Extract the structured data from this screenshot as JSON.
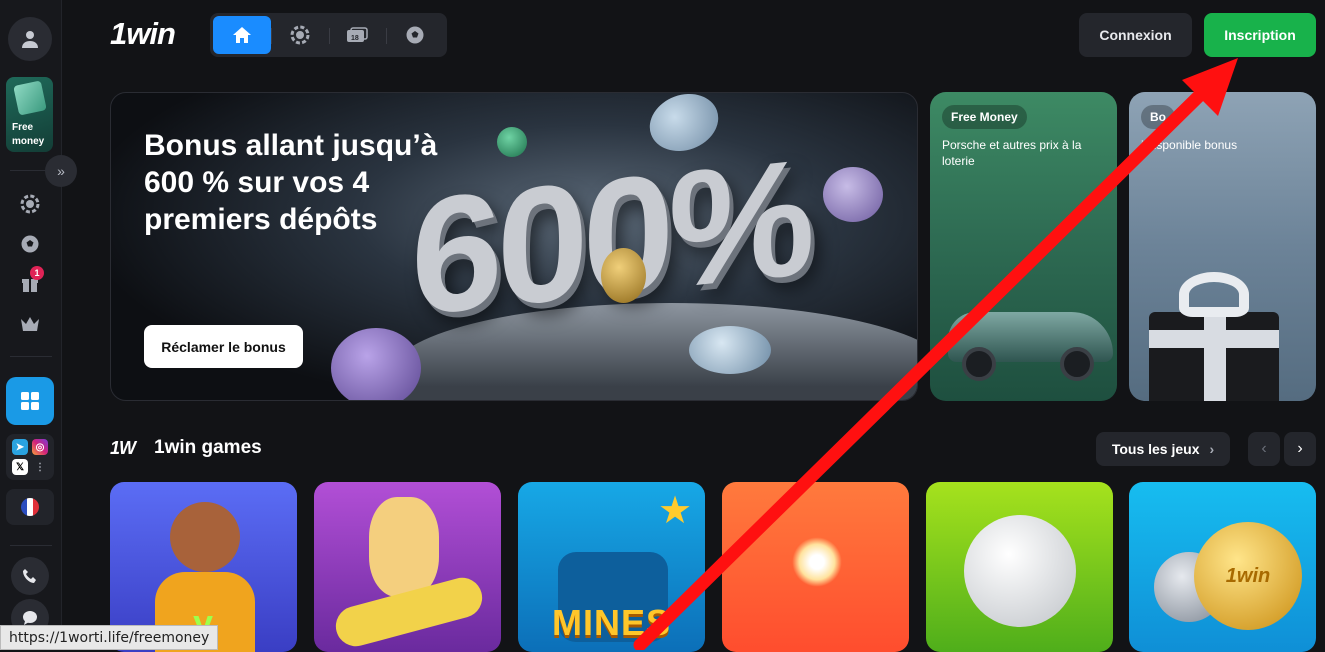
{
  "brand": {
    "logo_text": "1win"
  },
  "sidebar": {
    "free_money_label": "Free money",
    "badge_count": "1"
  },
  "header": {
    "tabs": [
      {
        "icon": "home-icon",
        "active": true
      },
      {
        "icon": "casino-chip-icon",
        "active": false
      },
      {
        "icon": "live-casino-icon",
        "active": false
      },
      {
        "icon": "football-icon",
        "active": false
      }
    ],
    "login_label": "Connexion",
    "signup_label": "Inscription"
  },
  "hero": {
    "title": "Bonus allant jusqu’à 600 % sur vos 4 premiers dépôts",
    "big_text": "600%",
    "cta_label": "Réclamer le bonus"
  },
  "promos": [
    {
      "chip": "Free Money",
      "description": "Porsche et autres prix à la loterie"
    },
    {
      "chip": "Bo",
      "description": "i disponible bonus"
    }
  ],
  "games_section": {
    "logo_mark": "1W",
    "title": "1win games",
    "all_label": "Tous les jeux",
    "prev_symbol": "‹",
    "next_symbol": "›",
    "cards": [
      {
        "label": "y"
      },
      {
        "label": ""
      },
      {
        "label": "MINES"
      },
      {
        "label": ""
      },
      {
        "label": ""
      },
      {
        "label": "1win"
      }
    ]
  },
  "status_bar": {
    "url": "https://1worti.life/freemoney"
  },
  "colors": {
    "accent_blue": "#1a8cff",
    "signup_green": "#18b24b",
    "annotation_red": "#ff1010"
  }
}
